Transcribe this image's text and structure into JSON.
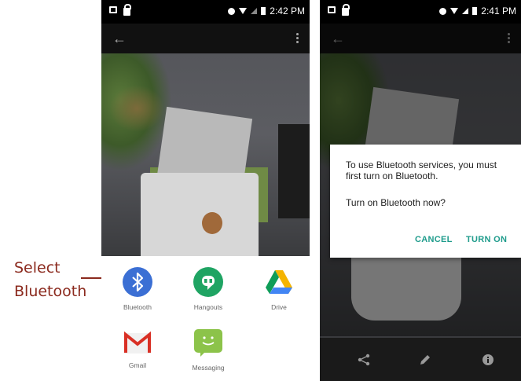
{
  "callout": {
    "line1": "Select",
    "line2": "Bluetooth"
  },
  "left_screen": {
    "status": {
      "time": "2:42 PM"
    },
    "share_targets": [
      {
        "label": "Bluetooth",
        "icon": "bluetooth-icon",
        "color": "#3b6fd4"
      },
      {
        "label": "Hangouts",
        "icon": "hangouts-icon",
        "color": "#1fa463"
      },
      {
        "label": "Drive",
        "icon": "drive-icon",
        "color": "#f4b400"
      },
      {
        "label": "Gmail",
        "icon": "gmail-icon",
        "color": "#d93025"
      },
      {
        "label": "Messaging",
        "icon": "messaging-icon",
        "color": "#8cc34a"
      }
    ]
  },
  "right_screen": {
    "status": {
      "time": "2:41 PM"
    },
    "dialog": {
      "message": "To use Bluetooth services, you must first turn on Bluetooth.",
      "question": "Turn on Bluetooth now?",
      "cancel_label": "CANCEL",
      "confirm_label": "TURN ON",
      "accent_color": "#1f9c8c"
    },
    "bottom_actions": [
      "share-icon",
      "edit-icon",
      "info-icon"
    ]
  }
}
